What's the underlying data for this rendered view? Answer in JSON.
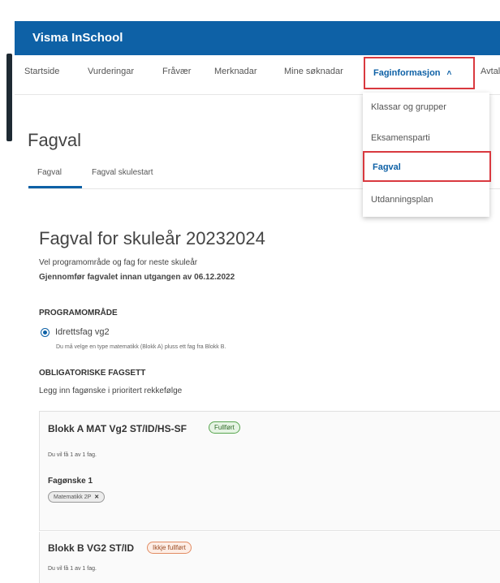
{
  "app": {
    "title": "Visma InSchool"
  },
  "nav": {
    "items": [
      "Startside",
      "Vurderingar",
      "Fråvær",
      "Merknadar",
      "Mine søknadar"
    ],
    "active": "Faginformasjon",
    "truncated": "Avtal"
  },
  "dropdown": {
    "items": [
      "Klassar og grupper",
      "Eksamensparti",
      "Fagval",
      "Utdanningsplan"
    ],
    "selected_index": 2
  },
  "page": {
    "title": "Fagval",
    "tabs": [
      "Fagval",
      "Fagval skulestart"
    ]
  },
  "main": {
    "heading": "Fagval for skuleår 20232024",
    "intro": "Vel programområde og fag for neste skuleår",
    "deadline": "Gjennomfør fagvalet innan utgangen av 06.12.2022",
    "program_label": "PROGRAMOMRÅDE",
    "program_option": "Idrettsfag vg2",
    "program_hint": "Du må velge en type matematikk (Blokk A) pluss ett fag fra Blokk B.",
    "sets_label": "OBLIGATORISKE FAGSETT",
    "sets_hint": "Legg inn fagønske i prioritert rekkefølge"
  },
  "blocks": [
    {
      "title": "Blokk A MAT Vg2 ST/ID/HS-SF",
      "status": "Fullført",
      "info": "Du vil få 1 av 1 fag.",
      "wish_label": "Fagønske 1",
      "chip": "Matematikk 2P"
    },
    {
      "title": "Blokk B VG2 ST/ID",
      "status": "Ikkje fullført",
      "info": "Du vil få 1 av 1 fag."
    }
  ],
  "colors": {
    "brand": "#0e61a6",
    "highlight": "#d9393f"
  }
}
